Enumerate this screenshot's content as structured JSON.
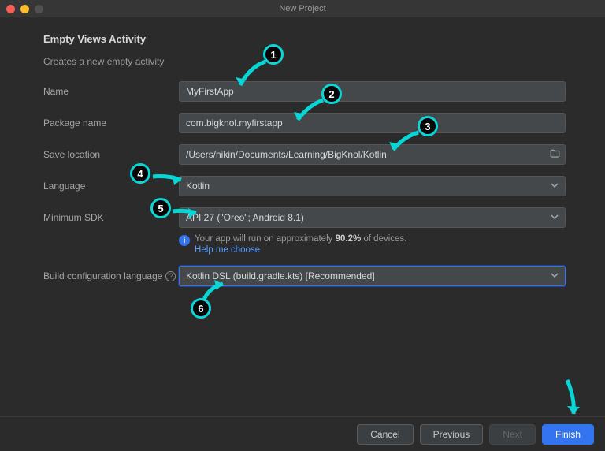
{
  "window": {
    "title": "New Project"
  },
  "header": {
    "title": "Empty Views Activity",
    "subtitle": "Creates a new empty activity"
  },
  "fields": {
    "name": {
      "label": "Name",
      "value": "MyFirstApp"
    },
    "package": {
      "label": "Package name",
      "value": "com.bigknol.myfirstapp"
    },
    "save": {
      "label": "Save location",
      "value": "/Users/nikin/Documents/Learning/BigKnol/Kotlin"
    },
    "language": {
      "label": "Language",
      "value": "Kotlin"
    },
    "minsdk": {
      "label": "Minimum SDK",
      "value": "API 27 (\"Oreo\"; Android 8.1)"
    },
    "buildlang": {
      "label": "Build configuration language",
      "value": "Kotlin DSL (build.gradle.kts) [Recommended]"
    }
  },
  "hint": {
    "prefix": "Your app will run on approximately ",
    "percent": "90.2%",
    "suffix": " of devices.",
    "link": "Help me choose"
  },
  "footer": {
    "cancel": "Cancel",
    "previous": "Previous",
    "next": "Next",
    "finish": "Finish"
  },
  "annotations": {
    "n1": "1",
    "n2": "2",
    "n3": "3",
    "n4": "4",
    "n5": "5",
    "n6": "6"
  }
}
